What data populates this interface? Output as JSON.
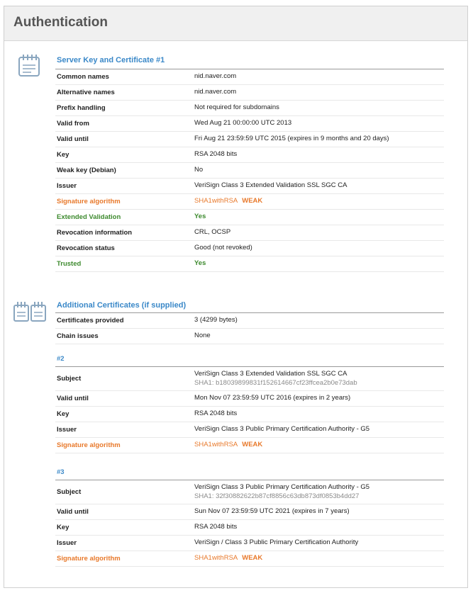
{
  "panel": {
    "title": "Authentication"
  },
  "server_key": {
    "title": "Server Key and Certificate #1",
    "rows": [
      {
        "label": "Common names",
        "value": "nid.naver.com"
      },
      {
        "label": "Alternative names",
        "value": "nid.naver.com"
      },
      {
        "label": "Prefix handling",
        "value": "Not required for subdomains"
      },
      {
        "label": "Valid from",
        "value": "Wed Aug 21 00:00:00 UTC 2013"
      },
      {
        "label": "Valid until",
        "value": "Fri Aug 21 23:59:59 UTC 2015 (expires in 9 months and 20 days)"
      },
      {
        "label": "Key",
        "value": "RSA 2048 bits"
      },
      {
        "label": "Weak key (Debian)",
        "value": "No"
      },
      {
        "label": "Issuer",
        "value": "VeriSign Class 3 Extended Validation SSL SGC CA"
      },
      {
        "label": "Signature algorithm",
        "value": "SHA1withRSA",
        "badge": "WEAK"
      },
      {
        "label": "Extended Validation",
        "value": "Yes"
      },
      {
        "label": "Revocation information",
        "value": "CRL, OCSP"
      },
      {
        "label": "Revocation status",
        "value": "Good (not revoked)"
      },
      {
        "label": "Trusted",
        "value": "Yes"
      }
    ]
  },
  "additional": {
    "title": "Additional Certificates (if supplied)",
    "rows": [
      {
        "label": "Certificates provided",
        "value": "3 (4299 bytes)"
      },
      {
        "label": "Chain issues",
        "value": "None"
      }
    ],
    "certs": [
      {
        "heading": "#2",
        "subject_label": "Subject",
        "subject": "VeriSign Class 3 Extended Validation SSL SGC CA",
        "sha": "SHA1: b18039899831f152614667cf23ffcea2b0e73dab",
        "rows": [
          {
            "label": "Valid until",
            "value": "Mon Nov 07 23:59:59 UTC 2016 (expires in 2 years)"
          },
          {
            "label": "Key",
            "value": "RSA 2048 bits"
          },
          {
            "label": "Issuer",
            "value": "VeriSign Class 3 Public Primary Certification Authority - G5"
          },
          {
            "label": "Signature algorithm",
            "value": "SHA1withRSA",
            "badge": "WEAK"
          }
        ]
      },
      {
        "heading": "#3",
        "subject_label": "Subject",
        "subject": "VeriSign Class 3 Public Primary Certification Authority - G5",
        "sha": "SHA1: 32f30882622b87cf8856c63db873df0853b4dd27",
        "rows": [
          {
            "label": "Valid until",
            "value": "Sun Nov 07 23:59:59 UTC 2021 (expires in 7 years)"
          },
          {
            "label": "Key",
            "value": "RSA 2048 bits"
          },
          {
            "label": "Issuer",
            "value": "VeriSign / Class 3 Public Primary Certification Authority"
          },
          {
            "label": "Signature algorithm",
            "value": "SHA1withRSA",
            "badge": "WEAK"
          }
        ]
      }
    ]
  },
  "colors": {
    "accent": "#3a88c8",
    "warn": "#e8792b",
    "good": "#3d8a2e"
  },
  "icons": {
    "server_key": "certificate-icon",
    "additional": "certificates-stack-icon"
  }
}
